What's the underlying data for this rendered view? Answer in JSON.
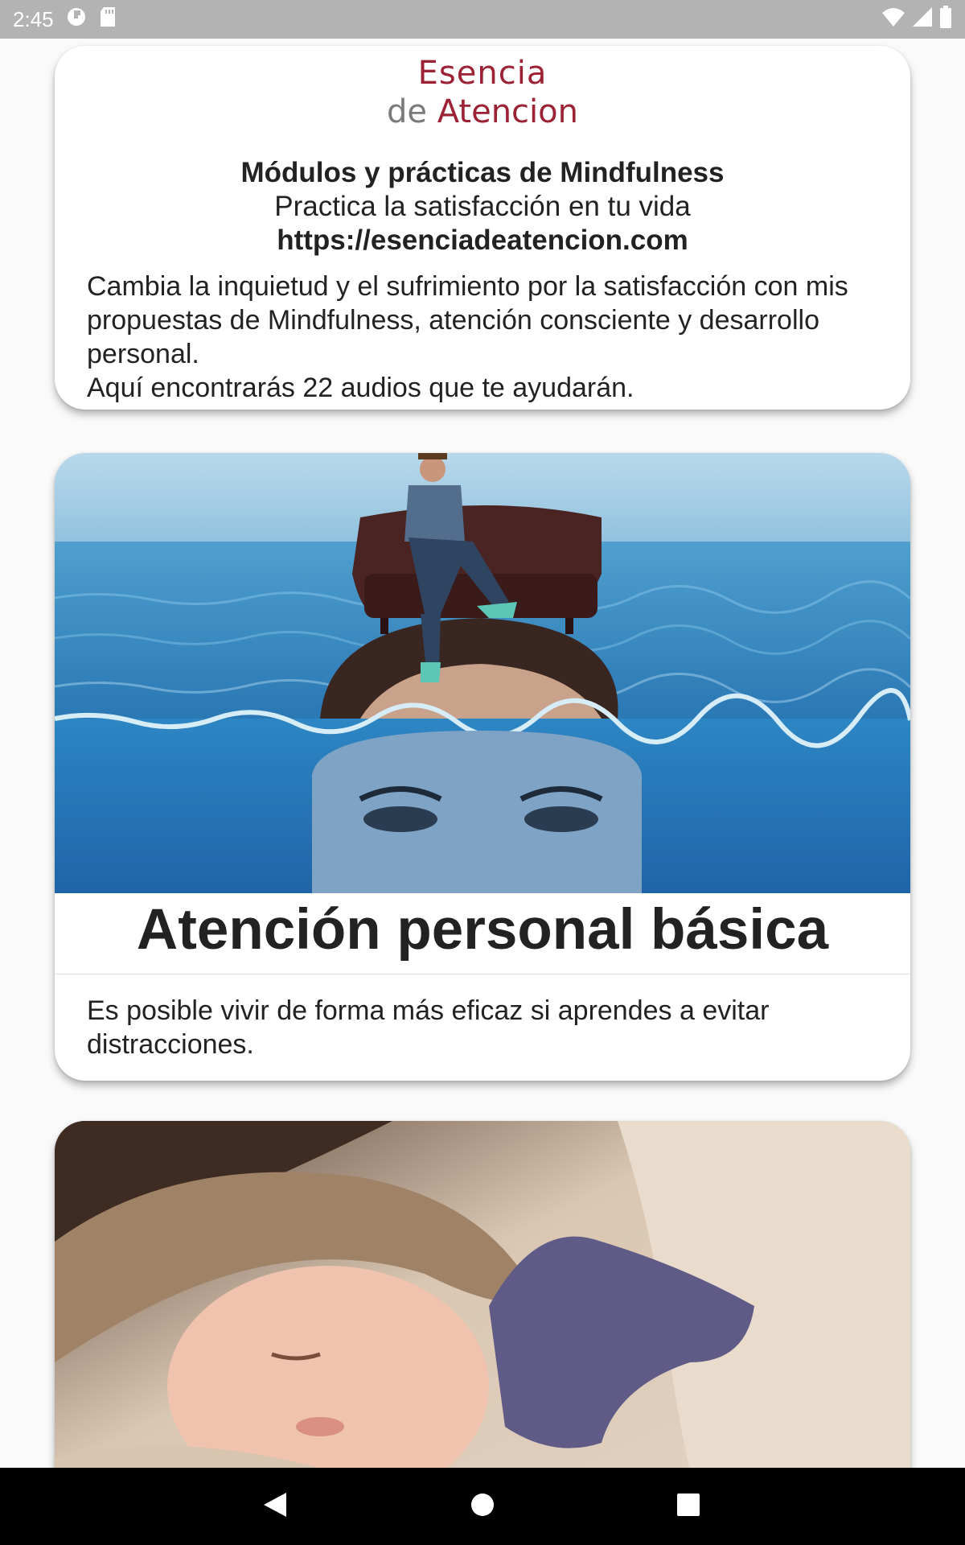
{
  "status_bar": {
    "time": "2:45",
    "icons": [
      "data-saver-icon",
      "sd-card-icon",
      "wifi-icon",
      "signal-icon",
      "battery-icon"
    ]
  },
  "intro": {
    "logo_line1": "Esencia",
    "logo_de": "de",
    "logo_atencion": "Atencion",
    "title": "Módulos y prácticas de Mindfulness",
    "subtitle": "Practica la satisfacción en tu vida",
    "url": "https://esenciadeatencion.com",
    "description_1": "Cambia la inquietud y el sufrimiento por la satisfacción con mis propuestas de Mindfulness, atención consciente y desarrollo personal.",
    "description_2": "Aquí encontrarás 22 audios que te ayudarán."
  },
  "modules": [
    {
      "title": "Atención personal básica",
      "description": "Es posible vivir de forma más eficaz si aprendes a evitar distracciones.",
      "image": "man-on-sofa-above-submerged-woman-head"
    },
    {
      "image": "sleeping-child"
    }
  ],
  "nav_bar": {
    "icons": [
      "back-icon",
      "home-icon",
      "recents-icon"
    ]
  },
  "colors": {
    "brand": "#9b2335",
    "status_bar": "#b3b3b3",
    "nav_bar": "#000000",
    "background": "#fafafa"
  }
}
